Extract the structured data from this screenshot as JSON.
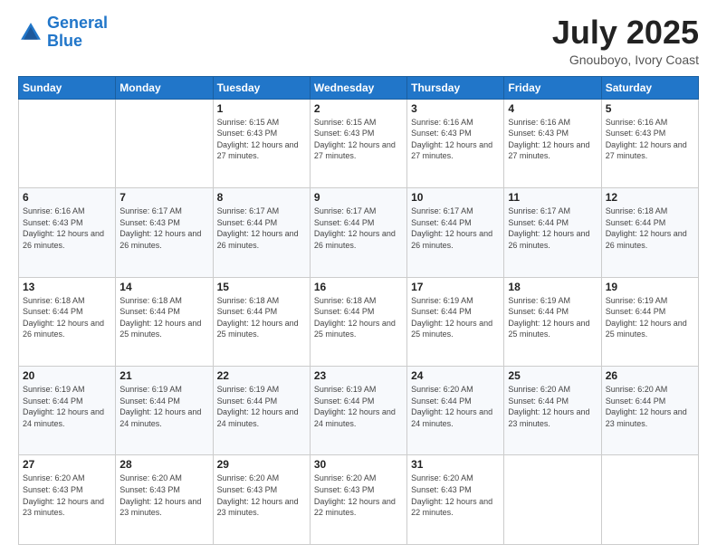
{
  "logo": {
    "line1": "General",
    "line2": "Blue"
  },
  "title": "July 2025",
  "location": "Gnouboyo, Ivory Coast",
  "days_of_week": [
    "Sunday",
    "Monday",
    "Tuesday",
    "Wednesday",
    "Thursday",
    "Friday",
    "Saturday"
  ],
  "weeks": [
    [
      {
        "day": "",
        "sunrise": "",
        "sunset": "",
        "daylight": ""
      },
      {
        "day": "",
        "sunrise": "",
        "sunset": "",
        "daylight": ""
      },
      {
        "day": "1",
        "sunrise": "Sunrise: 6:15 AM",
        "sunset": "Sunset: 6:43 PM",
        "daylight": "Daylight: 12 hours and 27 minutes."
      },
      {
        "day": "2",
        "sunrise": "Sunrise: 6:15 AM",
        "sunset": "Sunset: 6:43 PM",
        "daylight": "Daylight: 12 hours and 27 minutes."
      },
      {
        "day": "3",
        "sunrise": "Sunrise: 6:16 AM",
        "sunset": "Sunset: 6:43 PM",
        "daylight": "Daylight: 12 hours and 27 minutes."
      },
      {
        "day": "4",
        "sunrise": "Sunrise: 6:16 AM",
        "sunset": "Sunset: 6:43 PM",
        "daylight": "Daylight: 12 hours and 27 minutes."
      },
      {
        "day": "5",
        "sunrise": "Sunrise: 6:16 AM",
        "sunset": "Sunset: 6:43 PM",
        "daylight": "Daylight: 12 hours and 27 minutes."
      }
    ],
    [
      {
        "day": "6",
        "sunrise": "Sunrise: 6:16 AM",
        "sunset": "Sunset: 6:43 PM",
        "daylight": "Daylight: 12 hours and 26 minutes."
      },
      {
        "day": "7",
        "sunrise": "Sunrise: 6:17 AM",
        "sunset": "Sunset: 6:43 PM",
        "daylight": "Daylight: 12 hours and 26 minutes."
      },
      {
        "day": "8",
        "sunrise": "Sunrise: 6:17 AM",
        "sunset": "Sunset: 6:44 PM",
        "daylight": "Daylight: 12 hours and 26 minutes."
      },
      {
        "day": "9",
        "sunrise": "Sunrise: 6:17 AM",
        "sunset": "Sunset: 6:44 PM",
        "daylight": "Daylight: 12 hours and 26 minutes."
      },
      {
        "day": "10",
        "sunrise": "Sunrise: 6:17 AM",
        "sunset": "Sunset: 6:44 PM",
        "daylight": "Daylight: 12 hours and 26 minutes."
      },
      {
        "day": "11",
        "sunrise": "Sunrise: 6:17 AM",
        "sunset": "Sunset: 6:44 PM",
        "daylight": "Daylight: 12 hours and 26 minutes."
      },
      {
        "day": "12",
        "sunrise": "Sunrise: 6:18 AM",
        "sunset": "Sunset: 6:44 PM",
        "daylight": "Daylight: 12 hours and 26 minutes."
      }
    ],
    [
      {
        "day": "13",
        "sunrise": "Sunrise: 6:18 AM",
        "sunset": "Sunset: 6:44 PM",
        "daylight": "Daylight: 12 hours and 26 minutes."
      },
      {
        "day": "14",
        "sunrise": "Sunrise: 6:18 AM",
        "sunset": "Sunset: 6:44 PM",
        "daylight": "Daylight: 12 hours and 25 minutes."
      },
      {
        "day": "15",
        "sunrise": "Sunrise: 6:18 AM",
        "sunset": "Sunset: 6:44 PM",
        "daylight": "Daylight: 12 hours and 25 minutes."
      },
      {
        "day": "16",
        "sunrise": "Sunrise: 6:18 AM",
        "sunset": "Sunset: 6:44 PM",
        "daylight": "Daylight: 12 hours and 25 minutes."
      },
      {
        "day": "17",
        "sunrise": "Sunrise: 6:19 AM",
        "sunset": "Sunset: 6:44 PM",
        "daylight": "Daylight: 12 hours and 25 minutes."
      },
      {
        "day": "18",
        "sunrise": "Sunrise: 6:19 AM",
        "sunset": "Sunset: 6:44 PM",
        "daylight": "Daylight: 12 hours and 25 minutes."
      },
      {
        "day": "19",
        "sunrise": "Sunrise: 6:19 AM",
        "sunset": "Sunset: 6:44 PM",
        "daylight": "Daylight: 12 hours and 25 minutes."
      }
    ],
    [
      {
        "day": "20",
        "sunrise": "Sunrise: 6:19 AM",
        "sunset": "Sunset: 6:44 PM",
        "daylight": "Daylight: 12 hours and 24 minutes."
      },
      {
        "day": "21",
        "sunrise": "Sunrise: 6:19 AM",
        "sunset": "Sunset: 6:44 PM",
        "daylight": "Daylight: 12 hours and 24 minutes."
      },
      {
        "day": "22",
        "sunrise": "Sunrise: 6:19 AM",
        "sunset": "Sunset: 6:44 PM",
        "daylight": "Daylight: 12 hours and 24 minutes."
      },
      {
        "day": "23",
        "sunrise": "Sunrise: 6:19 AM",
        "sunset": "Sunset: 6:44 PM",
        "daylight": "Daylight: 12 hours and 24 minutes."
      },
      {
        "day": "24",
        "sunrise": "Sunrise: 6:20 AM",
        "sunset": "Sunset: 6:44 PM",
        "daylight": "Daylight: 12 hours and 24 minutes."
      },
      {
        "day": "25",
        "sunrise": "Sunrise: 6:20 AM",
        "sunset": "Sunset: 6:44 PM",
        "daylight": "Daylight: 12 hours and 23 minutes."
      },
      {
        "day": "26",
        "sunrise": "Sunrise: 6:20 AM",
        "sunset": "Sunset: 6:44 PM",
        "daylight": "Daylight: 12 hours and 23 minutes."
      }
    ],
    [
      {
        "day": "27",
        "sunrise": "Sunrise: 6:20 AM",
        "sunset": "Sunset: 6:43 PM",
        "daylight": "Daylight: 12 hours and 23 minutes."
      },
      {
        "day": "28",
        "sunrise": "Sunrise: 6:20 AM",
        "sunset": "Sunset: 6:43 PM",
        "daylight": "Daylight: 12 hours and 23 minutes."
      },
      {
        "day": "29",
        "sunrise": "Sunrise: 6:20 AM",
        "sunset": "Sunset: 6:43 PM",
        "daylight": "Daylight: 12 hours and 23 minutes."
      },
      {
        "day": "30",
        "sunrise": "Sunrise: 6:20 AM",
        "sunset": "Sunset: 6:43 PM",
        "daylight": "Daylight: 12 hours and 22 minutes."
      },
      {
        "day": "31",
        "sunrise": "Sunrise: 6:20 AM",
        "sunset": "Sunset: 6:43 PM",
        "daylight": "Daylight: 12 hours and 22 minutes."
      },
      {
        "day": "",
        "sunrise": "",
        "sunset": "",
        "daylight": ""
      },
      {
        "day": "",
        "sunrise": "",
        "sunset": "",
        "daylight": ""
      }
    ]
  ]
}
